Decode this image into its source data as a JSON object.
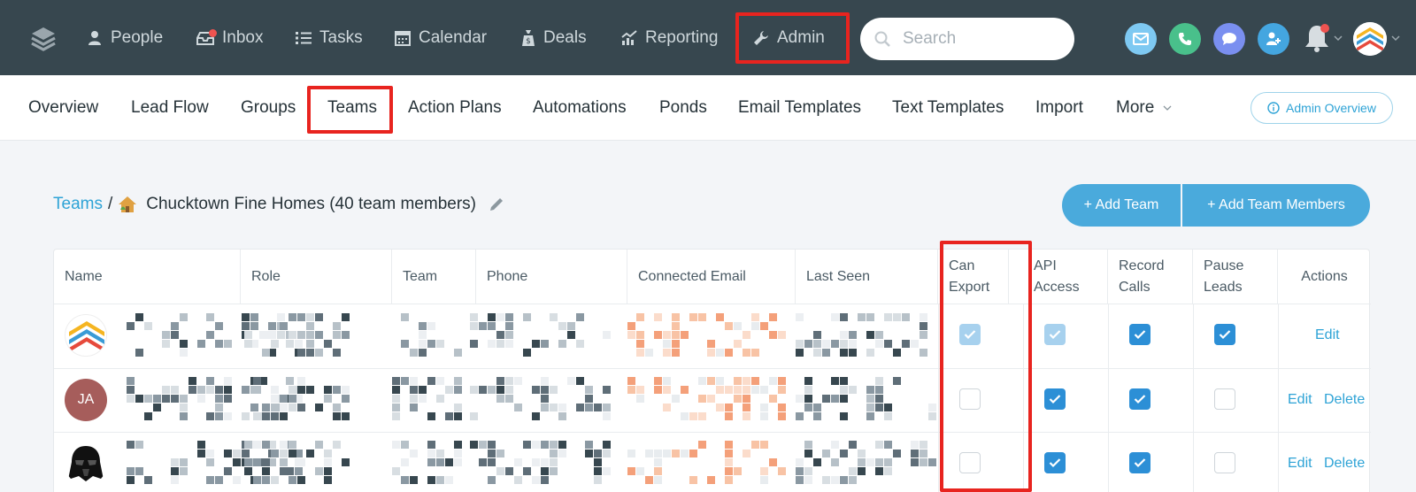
{
  "nav": {
    "items": [
      {
        "label": "People",
        "icon": "person-icon"
      },
      {
        "label": "Inbox",
        "icon": "inbox-icon"
      },
      {
        "label": "Tasks",
        "icon": "list-icon"
      },
      {
        "label": "Calendar",
        "icon": "calendar-icon"
      },
      {
        "label": "Deals",
        "icon": "money-bag-icon"
      },
      {
        "label": "Reporting",
        "icon": "chart-icon"
      },
      {
        "label": "Admin",
        "icon": "wrench-icon"
      }
    ],
    "search_placeholder": "Search",
    "quick_actions": [
      "email-icon",
      "phone-icon",
      "chat-icon",
      "add-person-icon"
    ]
  },
  "subnav": {
    "items": [
      "Overview",
      "Lead Flow",
      "Groups",
      "Teams",
      "Action Plans",
      "Automations",
      "Ponds",
      "Email Templates",
      "Text Templates",
      "Import",
      "More"
    ],
    "admin_overview": "Admin Overview"
  },
  "breadcrumb": {
    "root": "Teams",
    "separator": "/",
    "team_name": "Chucktown Fine Homes (40 team members)"
  },
  "buttons": {
    "add_team": "+ Add Team",
    "add_members": "+ Add Team Members"
  },
  "table": {
    "headers": [
      "Name",
      "Role",
      "Team",
      "Phone",
      "Connected Email",
      "Last Seen",
      "Can Export",
      "API Access",
      "Record Calls",
      "Pause Leads",
      "Actions"
    ],
    "rows": [
      {
        "avatar": "brand-logo",
        "initials": "",
        "can_export": "checked-disabled",
        "api_access": "checked-disabled",
        "record_calls": "checked",
        "pause_leads": "checked",
        "actions": [
          "Edit"
        ]
      },
      {
        "avatar": "initials",
        "initials": "JA",
        "can_export": "unchecked",
        "api_access": "checked",
        "record_calls": "checked",
        "pause_leads": "unchecked",
        "actions": [
          "Edit",
          "Delete"
        ]
      },
      {
        "avatar": "darth-vader",
        "initials": "",
        "can_export": "unchecked",
        "api_access": "checked",
        "record_calls": "checked",
        "pause_leads": "unchecked",
        "actions": [
          "Edit",
          "Delete"
        ]
      }
    ]
  },
  "colors": {
    "topnav_bg": "#37474f",
    "accent": "#2ea3d6",
    "checkbox": "#2c8fd6",
    "highlight": "#e8241f",
    "avatar_ja": "#a65d5b"
  }
}
